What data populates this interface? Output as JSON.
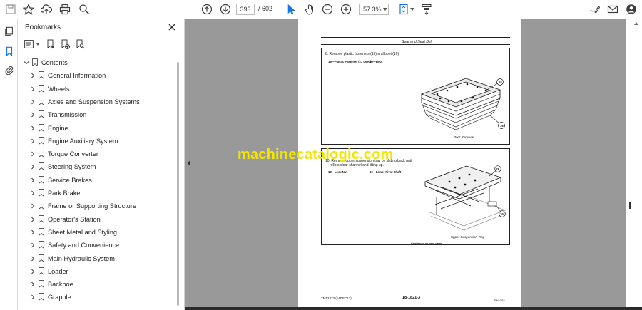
{
  "toolbar": {
    "current_page": "393",
    "page_separator": "/",
    "total_pages": "602",
    "zoom": "57.3%"
  },
  "bookmarks": {
    "title": "Bookmarks",
    "root": "Contents",
    "items": [
      "General Information",
      "Wheels",
      "Axles and Suspension Systems",
      "Transmission",
      "Engine",
      "Engine Auxiliary System",
      "Torque Converter",
      "Steering System",
      "Service Brakes",
      "Park Brake",
      "Frame or Supporting Structure",
      "Operator's Station",
      "Sheet Metal and Styling",
      "Safety and Convenience",
      "Main Hydraulic System",
      "Loader",
      "Backhoe",
      "Grapple"
    ]
  },
  "document": {
    "header": "Seat and Seat Belt",
    "step1": "8.   Remove plastic fasteners (15) and boot (16).",
    "legend1a": "15—Plastic Fastener (27 used)",
    "legend1b": "16—Boot",
    "caption1": "Boot Removal",
    "callout15": "15",
    "callout16": "16",
    "step2a": "10.  Remove upper suspension tray by sliding back until",
    "step2b": "rollers clear channel and lifting up.",
    "legend2a": "18—Lock Nut",
    "legend2b": "19—Lower Pivot Shaft",
    "caption2": "Upper Suspension Tray",
    "callout18": "18",
    "callout19": "19",
    "continued": "Continued on next page",
    "footer_left": "TM12472 (14DEC12)",
    "footer_center": "18-1821-3",
    "footer_right": "PN=393"
  },
  "watermark": "machinecatalogic.com"
}
